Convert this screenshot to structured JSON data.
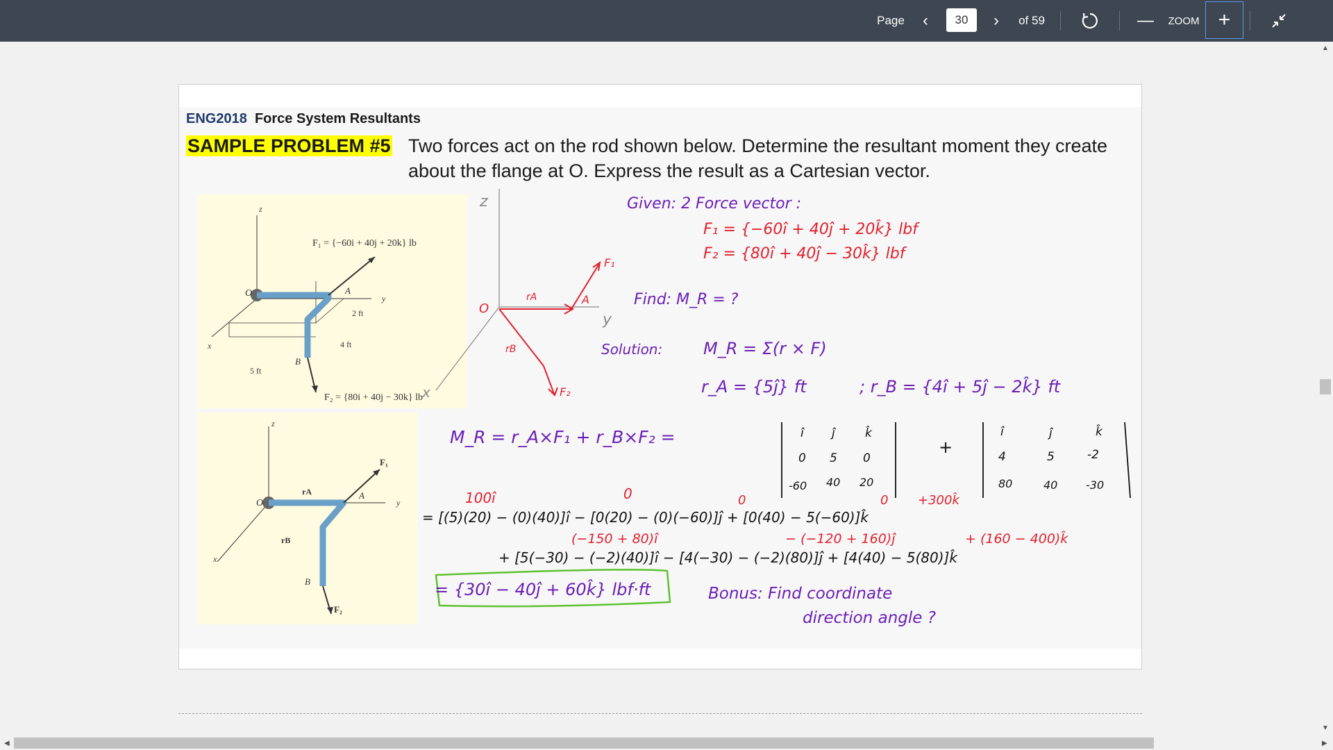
{
  "toolbar": {
    "page_label": "Page",
    "current_page": "30",
    "of_total": "of 59",
    "zoom_label": "ZOOM",
    "icons": [
      "chevron-left-icon",
      "chevron-right-icon",
      "refresh-icon",
      "minus-icon",
      "plus-icon",
      "collapse-icon"
    ]
  },
  "slide": {
    "course_code": "ENG2018",
    "course_title": "Force System Resultants",
    "problem_label": "SAMPLE PROBLEM #5",
    "problem_text": "Two forces act on the rod shown below. Determine the resultant moment they create about the flange at O. Express the result as a Cartesian vector."
  },
  "figure1": {
    "f1": "F₁ = {−60i + 40j + 20k} lb",
    "f2": "F₂ = {80i + 40j − 30k} lb",
    "z": "z",
    "y": "y",
    "x": "x",
    "O": "O",
    "A": "A",
    "B": "B",
    "dim_2ft": "2 ft",
    "dim_4ft": "4 ft",
    "dim_5ft": "5 ft"
  },
  "figure2": {
    "z": "z",
    "y": "y",
    "x": "x",
    "O": "O",
    "A": "A",
    "B": "B",
    "F1": "F₁",
    "F2": "F₂",
    "rA": "rA",
    "rB": "rB"
  },
  "notes": {
    "given": "Given: 2 Force vector :",
    "f1": "F₁ = {−60î + 40ĵ + 20k̂} lbf",
    "f2": "F₂ = {80î + 40ĵ − 30k̂} lbf",
    "find": "Find: M_R = ?",
    "solution": "Solution:",
    "mr_def": "M_R = Σ(r × F)",
    "ra": "r_A = {5ĵ} ft",
    "rb": "; r_B = {4î + 5ĵ − 2k̂} ft",
    "mr_eq": "M_R = r_A×F₁ + r_B×F₂ =",
    "det1": [
      "î",
      "ĵ",
      "k̂",
      "0",
      "5",
      "0",
      "-60",
      "40",
      "20"
    ],
    "det2": [
      "î",
      "ĵ",
      "k̂",
      "4",
      "5",
      "-2",
      "80",
      "40",
      "-30"
    ],
    "plus": "+",
    "line1": "= [(5)(20) − (0)(40)]î − [0(20) − (0)(−60)]ĵ + [0(40) − 5(−60)]k̂",
    "line1_red_a": "100î",
    "line1_red_b": "0",
    "line1_red_c": "0",
    "line1_red_d": "0",
    "line1_red_e": "+300k̂",
    "line2_red_a": "(−150 + 80)î",
    "line2_red_b": "− (−120 + 160)ĵ",
    "line2_red_c": "+ (160 − 400)k̂",
    "line2": "+ [5(−30) − (−2)(40)]î − [4(−30) − (−2)(80)]ĵ + [4(40) − 5(80)]k̂",
    "answer": "= {30î − 40ĵ + 60k̂} lbf·ft",
    "bonus1": "Bonus: Find coordinate",
    "bonus2": "direction angle ?",
    "sketch": {
      "z": "z",
      "y": "y",
      "x": "x",
      "O": "O",
      "A": "A",
      "rA": "rA",
      "rB": "rB",
      "F1": "F₁",
      "F2": "F₂"
    }
  },
  "colors": {
    "toolbar": "#3d4651",
    "highlight": "#ffff00",
    "ink_blue": "#6a1fb6",
    "ink_red": "#e0212e",
    "ink_green": "#5ec12e",
    "figure_bg": "#fffbe0"
  }
}
